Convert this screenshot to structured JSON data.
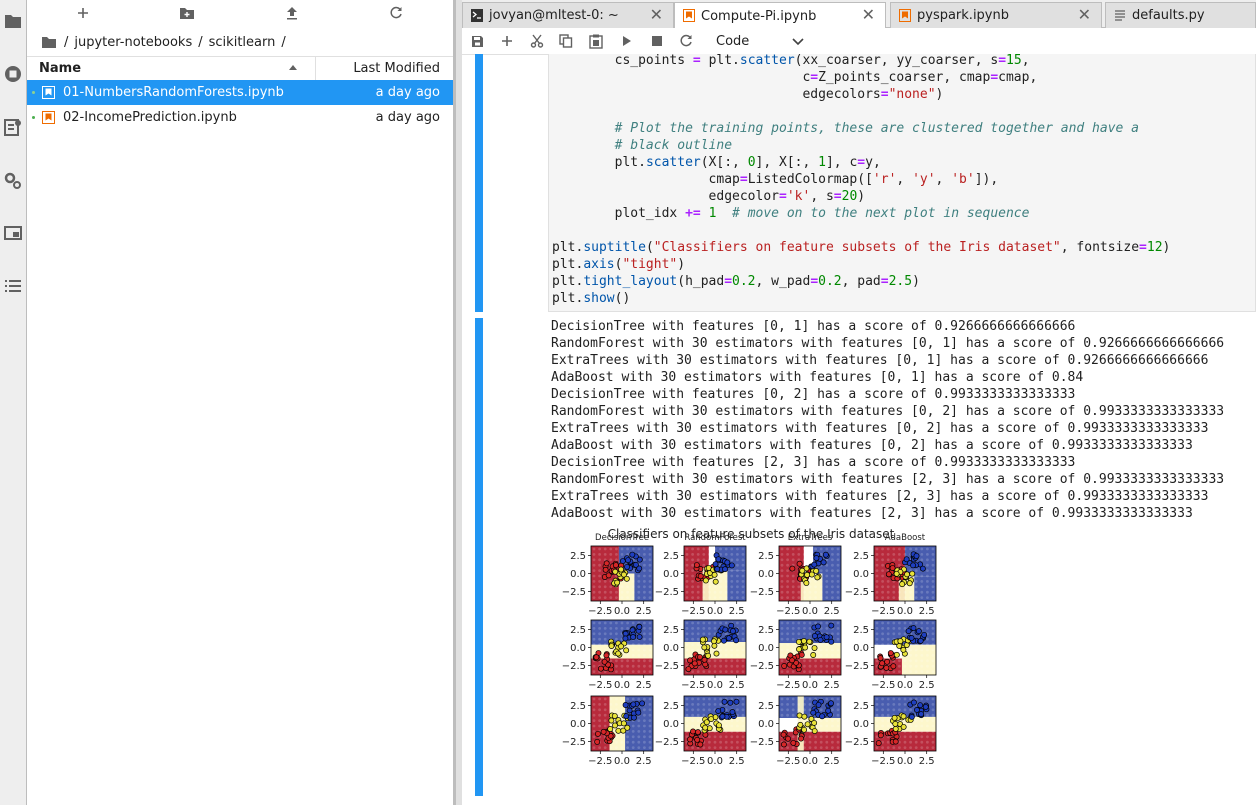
{
  "file_browser": {
    "breadcrumbs": [
      "/",
      "jupyter-notebooks",
      "/",
      "scikitlearn",
      "/"
    ],
    "columns": {
      "name": "Name",
      "modified": "Last Modified"
    },
    "files": [
      {
        "name": "01-NumbersRandomForests.ipynb",
        "modified": "a day ago",
        "selected": true
      },
      {
        "name": "02-IncomePrediction.ipynb",
        "modified": "a day ago",
        "selected": false
      }
    ]
  },
  "tabs": [
    {
      "label": "jovyan@mltest-0: ~",
      "icon": "terminal-icon"
    },
    {
      "label": "Compute-Pi.ipynb",
      "icon": "notebook-icon"
    },
    {
      "label": "pyspark.ipynb",
      "icon": "notebook-icon"
    },
    {
      "label": "defaults.py",
      "icon": "file-icon"
    }
  ],
  "toolbar": {
    "cell_type": "Code"
  },
  "code_lines": [
    "        cs_points = plt.scatter(xx_coarser, yy_coarser, s=15,",
    "                                c=Z_points_coarser, cmap=cmap,",
    "                                edgecolors=\"none\")",
    "",
    "        # Plot the training points, these are clustered together and have a",
    "        # black outline",
    "        plt.scatter(X[:, 0], X[:, 1], c=y,",
    "                    cmap=ListedColormap(['r', 'y', 'b']),",
    "                    edgecolor='k', s=20)",
    "        plot_idx += 1  # move on to the next plot in sequence",
    "",
    "plt.suptitle(\"Classifiers on feature subsets of the Iris dataset\", fontsize=12)",
    "plt.axis(\"tight\")",
    "plt.tight_layout(h_pad=0.2, w_pad=0.2, pad=2.5)",
    "plt.show()"
  ],
  "output_lines": [
    "DecisionTree with features [0, 1] has a score of 0.9266666666666666",
    "RandomForest with 30 estimators with features [0, 1] has a score of 0.9266666666666666",
    "ExtraTrees with 30 estimators with features [0, 1] has a score of 0.9266666666666666",
    "AdaBoost with 30 estimators with features [0, 1] has a score of 0.84",
    "DecisionTree with features [0, 2] has a score of 0.9933333333333333",
    "RandomForest with 30 estimators with features [0, 2] has a score of 0.9933333333333333",
    "ExtraTrees with 30 estimators with features [0, 2] has a score of 0.9933333333333333",
    "AdaBoost with 30 estimators with features [0, 2] has a score of 0.9933333333333333",
    "DecisionTree with features [2, 3] has a score of 0.9933333333333333",
    "RandomForest with 30 estimators with features [2, 3] has a score of 0.9933333333333333",
    "ExtraTrees with 30 estimators with features [2, 3] has a score of 0.9933333333333333",
    "AdaBoost with 30 estimators with features [2, 3] has a score of 0.9933333333333333"
  ],
  "figure": {
    "title": "Classifiers on feature subsets of the Iris dataset",
    "column_titles": [
      "DecisionTree",
      "RandomForest",
      "ExtraTrees",
      "AdaBoost"
    ],
    "yticks": [
      "2.5",
      "0.0",
      "−2.5"
    ],
    "xticks": [
      "−2.5",
      "0.0",
      "2.5"
    ]
  },
  "colors": {
    "accent": "#2196f3",
    "region_red": "#b2182b",
    "region_yellow": "#fdf6c8",
    "region_blue": "#3a4fa8"
  }
}
